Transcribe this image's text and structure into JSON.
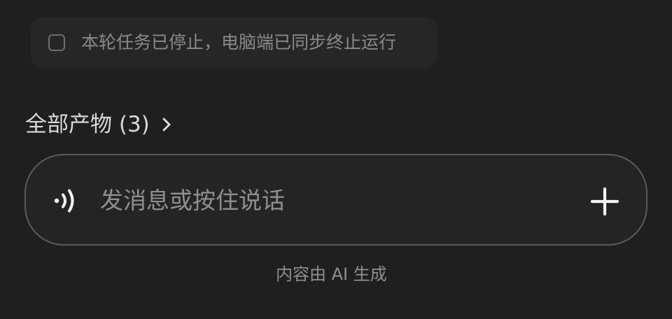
{
  "status_card": {
    "text": "本轮任务已停止，电脑端已同步终止运行",
    "icon": "checkbox-icon"
  },
  "artifacts": {
    "label": "全部产物 (3)",
    "icon": "chevron-right-icon"
  },
  "composer": {
    "placeholder": "发消息或按住说话",
    "value": "",
    "voice_icon": "voice-wave-icon",
    "add_icon": "plus-icon"
  },
  "footer": {
    "note": "内容由 AI 生成"
  },
  "colors": {
    "background": "#1f1f1f",
    "card": "#262626",
    "input_bg": "#242424",
    "input_border": "#5a5a5a",
    "text_primary": "#d9d9d9",
    "text_secondary": "#8f8f8f"
  }
}
